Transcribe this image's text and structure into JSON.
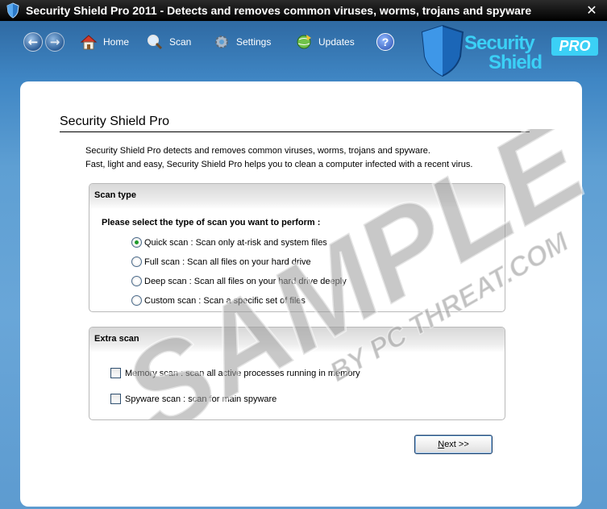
{
  "window": {
    "title": "Security Shield Pro 2011 - Detects and removes common viruses, worms, trojans and spyware",
    "close_label": "✕"
  },
  "toolbar": {
    "back_label": "←",
    "forward_label": "→",
    "home_label": "Home",
    "scan_label": "Scan",
    "settings_label": "Settings",
    "updates_label": "Updates",
    "help_label": "?"
  },
  "brand": {
    "word1": "Security",
    "word2": "Shield",
    "badge": "PRO"
  },
  "content": {
    "heading": "Security Shield Pro",
    "description_line1": "Security Shield Pro detects and removes common viruses, worms, trojans and spyware.",
    "description_line2": "Fast, light and easy, Security Shield Pro helps you to clean a computer infected with a recent virus."
  },
  "scan_type": {
    "title": "Scan type",
    "prompt": "Please select the type of scan you want to perform :",
    "options": [
      {
        "label": "Quick scan :  Scan only at-risk and system files",
        "checked": true
      },
      {
        "label": "Full scan : Scan all files on your hard drive",
        "checked": false
      },
      {
        "label": "Deep scan : Scan all files on your hard drive deeply",
        "checked": false
      },
      {
        "label": "Custom scan : Scan a specific set of files",
        "checked": false
      }
    ]
  },
  "extra_scan": {
    "title": "Extra scan",
    "options": [
      {
        "label": "Memory scan : scan all active processes running in memory",
        "checked": false
      },
      {
        "label": "Spyware scan : scan for main spyware",
        "checked": false
      }
    ]
  },
  "next_button": {
    "label_underlined": "N",
    "label_rest": "ext >>"
  },
  "watermark": {
    "line1": "SAMPLE",
    "line2": "BY PC THREAT.COM"
  },
  "colors": {
    "brand_cyan": "#3bd0f6",
    "window_blue": "#5e9fd3",
    "radio_selected": "#1f9a2a"
  }
}
